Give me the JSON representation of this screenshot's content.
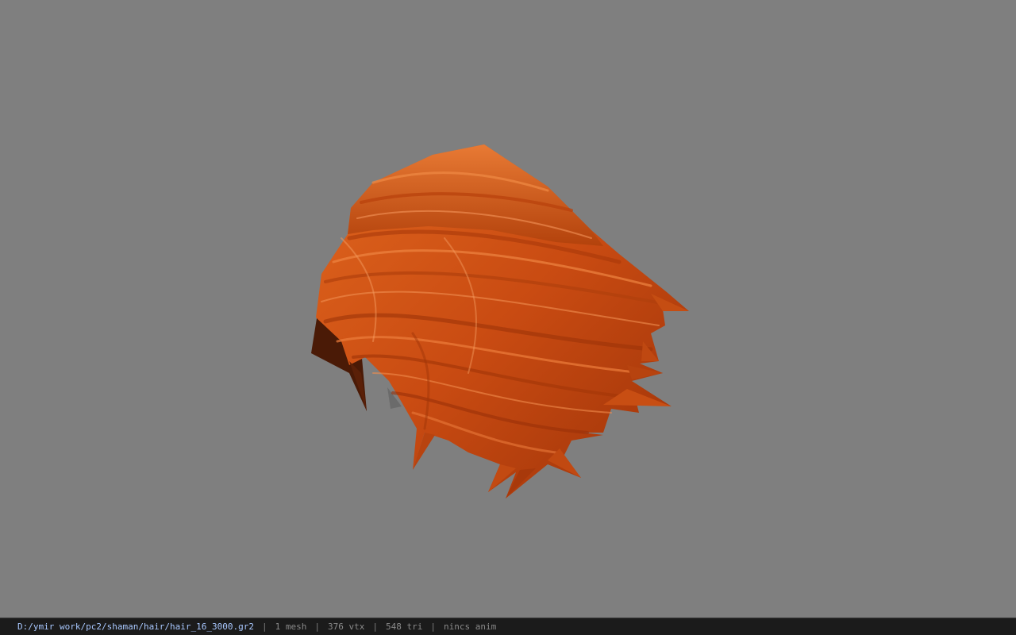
{
  "model": {
    "file_path": "D:/ymir work/pc2/shaman/hair/hair_16_3000.gr2",
    "texture_color": "#d9581b"
  },
  "stats": {
    "meshes": "1 mesh",
    "vertices": "376 vtx",
    "triangles": "548 tri",
    "anim": "nincs anim"
  },
  "colors": {
    "background": "#7f7f7f",
    "statusbar": "#1b1b1b",
    "path_text": "#a9c8ff"
  }
}
